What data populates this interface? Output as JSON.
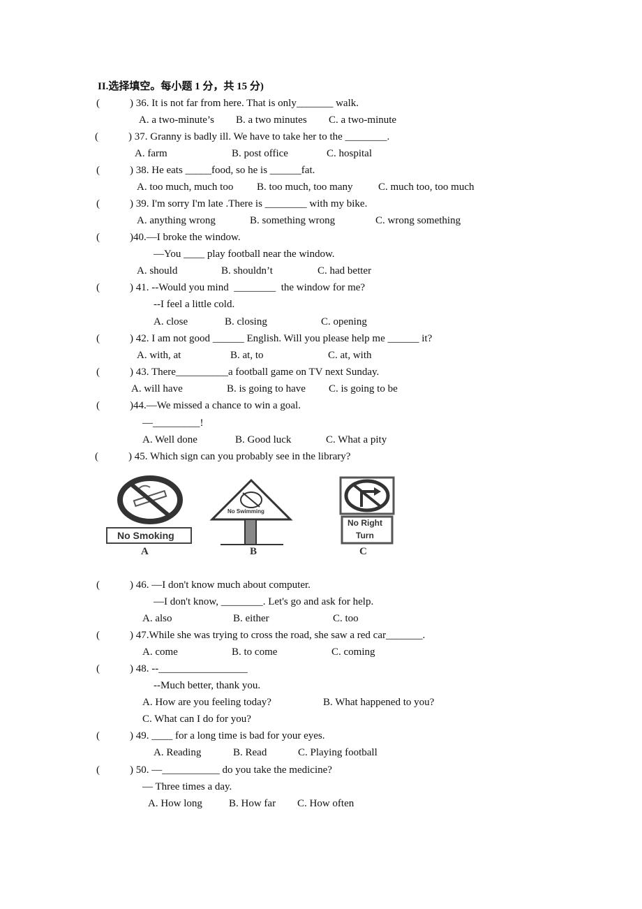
{
  "section_title": "II.选择填空。每小题 1 分，共 15 分)",
  "questions": [
    {
      "num": "36",
      "paren": "(",
      "close": ")",
      "stem": ") 36. It is not far from here. That is only_______ walk.",
      "options": [
        "A. a two-minute’s",
        "B. a two minutes",
        "C. a two-minute"
      ]
    },
    {
      "num": "37",
      "paren": "(",
      "stem": ") 37. Granny is badly ill. We have to take her to the ________.",
      "options": [
        "A. farm",
        "B. post office",
        "C. hospital"
      ]
    },
    {
      "num": "38",
      "paren": "(",
      "stem": ") 38. He eats _____food, so he is ______fat.",
      "options": [
        "A. too much, much too",
        "B. too much, too many",
        "C. much too, too much"
      ]
    },
    {
      "num": "39",
      "paren": "(",
      "stem": ") 39. I'm sorry I'm late .There is ________ with my bike.",
      "options": [
        "A. anything wrong",
        "B. something wrong",
        "C. wrong something"
      ]
    },
    {
      "num": "40",
      "paren": "(",
      "stem": ")40.—I broke the window.",
      "stem2": "—You ____ play football near the window.",
      "options": [
        "A. should",
        "B. shouldn’t",
        "C. had better"
      ]
    },
    {
      "num": "41",
      "paren": "(",
      "stem": ") 41. --Would you mind  ________  the window for me?",
      "stem2": "--I feel a little cold.",
      "options": [
        "A. close",
        "B. closing",
        "C. opening"
      ]
    },
    {
      "num": "42",
      "paren": "(",
      "stem": ") 42. I am not good ______ English. Will you please help me ______ it?",
      "options": [
        "A. with, at",
        "B. at, to",
        "C. at, with"
      ]
    },
    {
      "num": "43",
      "paren": "(",
      "stem": ") 43. There__________a football game on TV next Sunday.",
      "options": [
        "A. will have",
        "B. is going to have",
        "C. is going to be"
      ]
    },
    {
      "num": "44",
      "paren": "(",
      "stem": ")44.—We missed a chance to win a goal.",
      "stem2": "—_________!",
      "options": [
        "A. Well done",
        "B. Good luck",
        "C. What a pity"
      ]
    },
    {
      "num": "45",
      "paren": "(",
      "stem": ") 45. Which sign can you probably see in the library?",
      "signs": [
        {
          "letter": "A",
          "text": "No Smoking"
        },
        {
          "letter": "B",
          "text": "No Swimming"
        },
        {
          "letter": "C",
          "text_line1": "No Right",
          "text_line2": "Turn"
        }
      ]
    },
    {
      "num": "46",
      "paren": "(",
      "stem": ") 46. —I don't know much about computer.",
      "stem2": "—I don't know, ________. Let's go and ask for help.",
      "options": [
        "A. also",
        "B. either",
        "C. too"
      ]
    },
    {
      "num": "47",
      "paren": "(",
      "stem": ") 47.While she was trying to cross the road, she saw a red car_______.",
      "options": [
        "A. come",
        "B. to come",
        "C. coming"
      ]
    },
    {
      "num": "48",
      "paren": "(",
      "stem": ") 48. --_________________",
      "stem2": "--Much better, thank you.",
      "options": [
        "A. How are you feeling today?",
        "B. What happened to you?",
        "C. What can I do for you?"
      ]
    },
    {
      "num": "49",
      "paren": "(",
      "stem": ") 49. ____ for a long time is bad for your eyes.",
      "options": [
        "A. Reading",
        "B. Read",
        "C. Playing football"
      ]
    },
    {
      "num": "50",
      "paren": "(",
      "stem": ") 50. —___________ do you take the medicine?",
      "stem2": "— Three times a day.",
      "options": [
        "A. How long",
        "B. How far",
        "C. How often"
      ]
    }
  ]
}
